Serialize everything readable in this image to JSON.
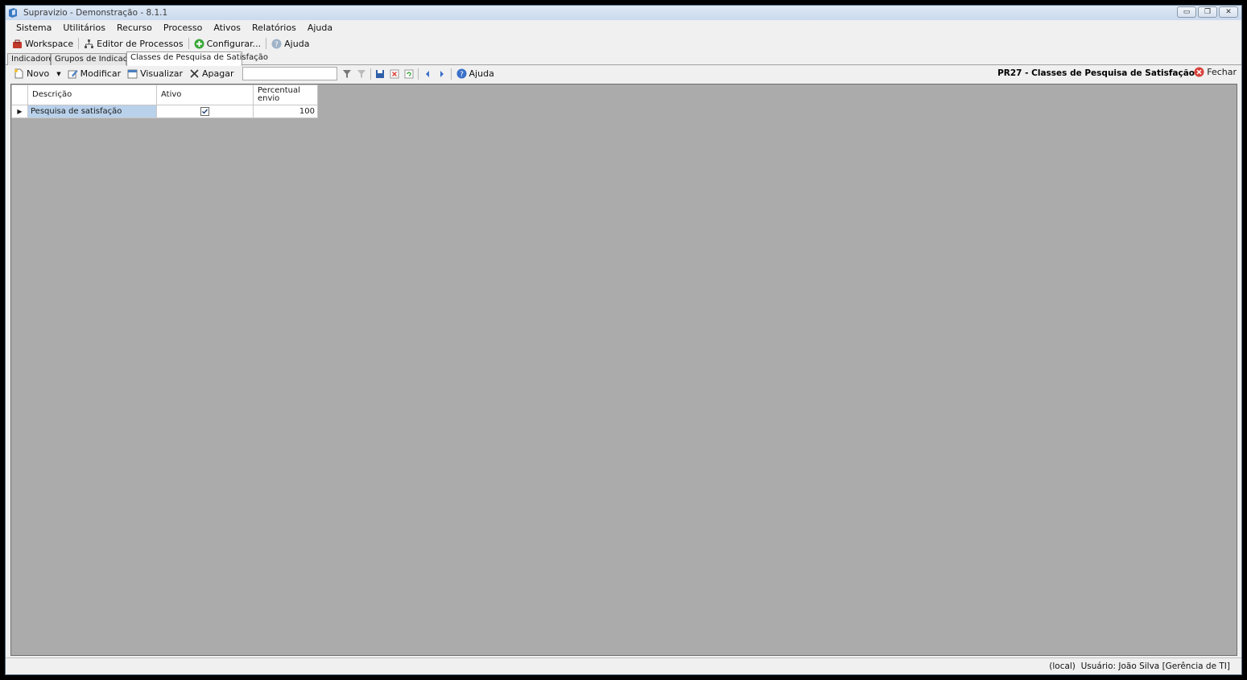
{
  "window": {
    "title": "Supravizio - Demonstração - 8.1.1",
    "controls": {
      "minimize": "▭",
      "restore": "❐",
      "close": "✕"
    }
  },
  "menu": [
    "Sistema",
    "Utilitários",
    "Recurso",
    "Processo",
    "Ativos",
    "Relatórios",
    "Ajuda"
  ],
  "toolbar": {
    "workspace": "Workspace",
    "editor": "Editor de Processos",
    "configurar": "Configurar...",
    "ajuda": "Ajuda"
  },
  "tabs": [
    "Indicadores",
    "Grupos de Indicadores",
    "Classes de Pesquisa de Satisfação"
  ],
  "form_toolbar": {
    "novo": "Novo",
    "modificar": "Modificar",
    "visualizar": "Visualizar",
    "apagar": "Apagar",
    "search_value": "",
    "ajuda": "Ajuda",
    "form_title": "PR27 - Classes de Pesquisa de Satisfação",
    "fechar": "Fechar"
  },
  "grid": {
    "columns": [
      "Descrição",
      "Ativo",
      "Percentual envio"
    ],
    "rows": [
      {
        "descricao": "Pesquisa de satisfação",
        "ativo": true,
        "percentual": "100"
      }
    ]
  },
  "status": {
    "text": "(local)  Usuário: João Silva [Gerência de TI]"
  },
  "colors": {
    "grid_background": "#ababab",
    "selected_cell": "#b9d1ea",
    "close_icon": "#d9423a",
    "add_icon": "#3aa83a",
    "help_icon": "#3a6fc9"
  }
}
